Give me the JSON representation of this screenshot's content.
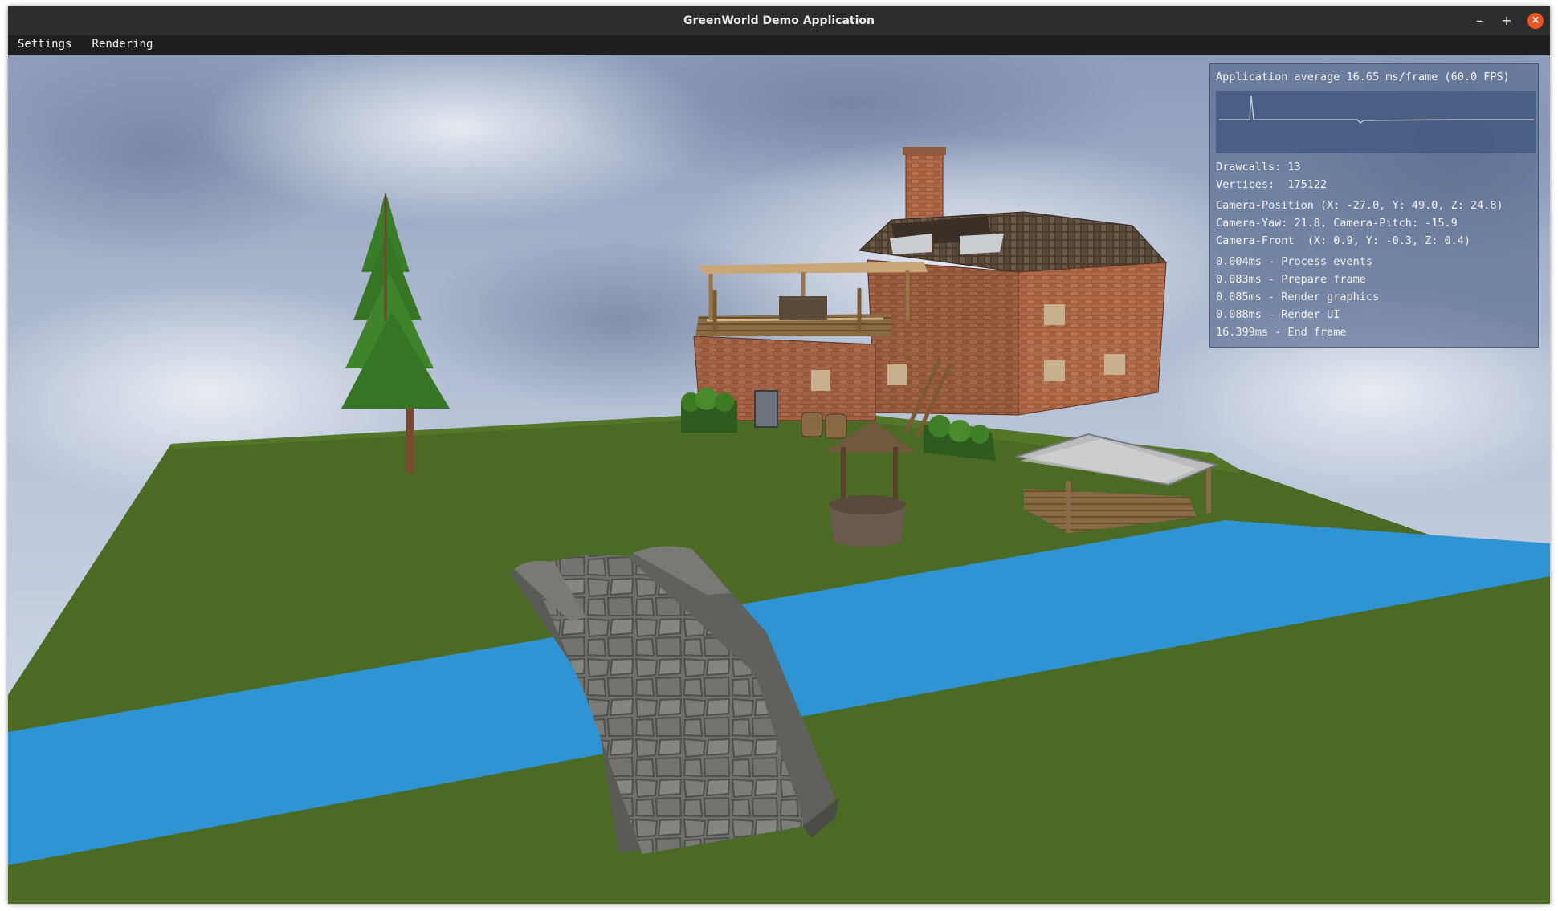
{
  "window": {
    "title": "GreenWorld Demo Application",
    "controls": {
      "minimize": "–",
      "maximize": "+",
      "close": "×"
    }
  },
  "menubar": {
    "items": [
      {
        "label": "Settings"
      },
      {
        "label": "Rendering"
      }
    ]
  },
  "colors": {
    "grass": "#4b6b25",
    "water": "#2f94d3",
    "sky": "#a9b6ce"
  },
  "overlay": {
    "fps_summary": "Application average 16.65 ms/frame (60.0 FPS)",
    "drawcalls": "Drawcalls: 13",
    "vertices": "Vertices:  175122",
    "camera_position": "Camera-Position (X: -27.0, Y: 49.0, Z: 24.8)",
    "camera_yaw_pitch": "Camera-Yaw: 21.8, Camera-Pitch: -15.9",
    "camera_front": "Camera-Front  (X: 0.9, Y: -0.3, Z: 0.4)",
    "timings": [
      "0.004ms - Process events",
      "0.083ms - Prepare frame",
      "0.085ms - Render graphics",
      "0.088ms - Render UI",
      "16.399ms - End frame"
    ]
  },
  "scene_objects": [
    "fir-tree",
    "brick-house",
    "wooden-well",
    "market-stall",
    "stone-bridge",
    "river"
  ]
}
